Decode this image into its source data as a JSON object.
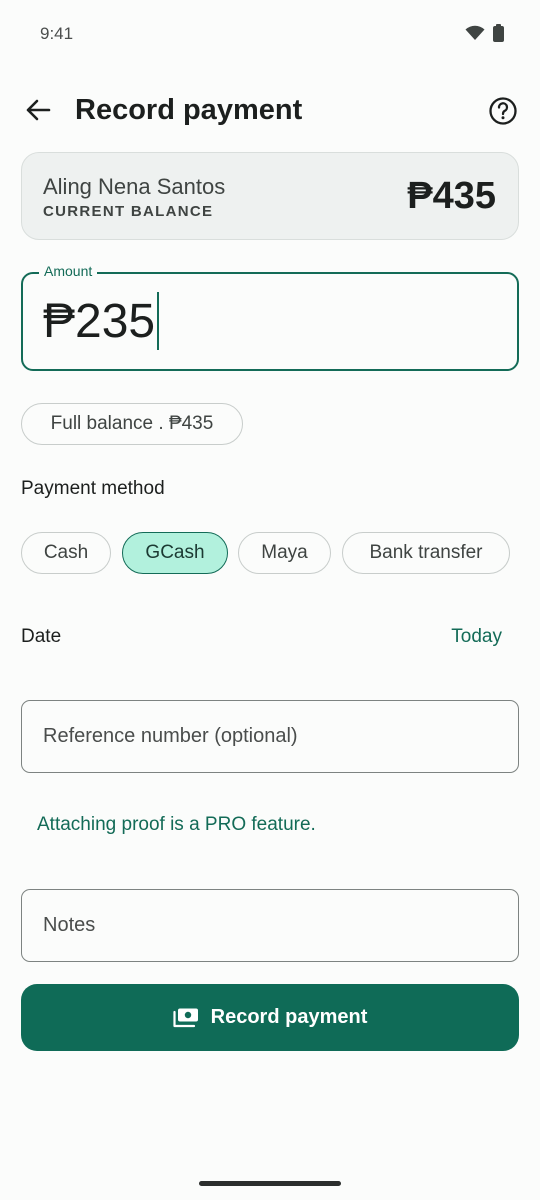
{
  "status_bar": {
    "time": "9:41",
    "wifi_icon": "wifi-icon",
    "battery_icon": "battery-icon"
  },
  "app_bar": {
    "title": "Record payment",
    "back_icon": "arrow-back-icon",
    "help_icon": "help-circle-icon"
  },
  "balance_card": {
    "name": "Aling Nena Santos",
    "caption": "CURRENT BALANCE",
    "amount": "₱435"
  },
  "amount_field": {
    "label": "Amount",
    "value": "₱235"
  },
  "quick_fill": {
    "label": "Full balance . ₱435"
  },
  "payment_method": {
    "label": "Payment method",
    "options": [
      {
        "label": "Cash",
        "selected": false
      },
      {
        "label": "GCash",
        "selected": true
      },
      {
        "label": "Maya",
        "selected": false
      },
      {
        "label": "Bank transfer",
        "selected": false
      }
    ]
  },
  "date": {
    "label": "Date",
    "value": "Today"
  },
  "reference": {
    "placeholder": "Reference number (optional)"
  },
  "pro_note": "Attaching proof is a PRO feature.",
  "notes": {
    "placeholder": "Notes"
  },
  "submit": {
    "label": "Record payment",
    "icon": "cash-icon"
  },
  "colors": {
    "accent": "#136b57",
    "button": "#0f6b57",
    "chip_selected": "#b2f1dd",
    "card_bg": "#eef1f0"
  }
}
